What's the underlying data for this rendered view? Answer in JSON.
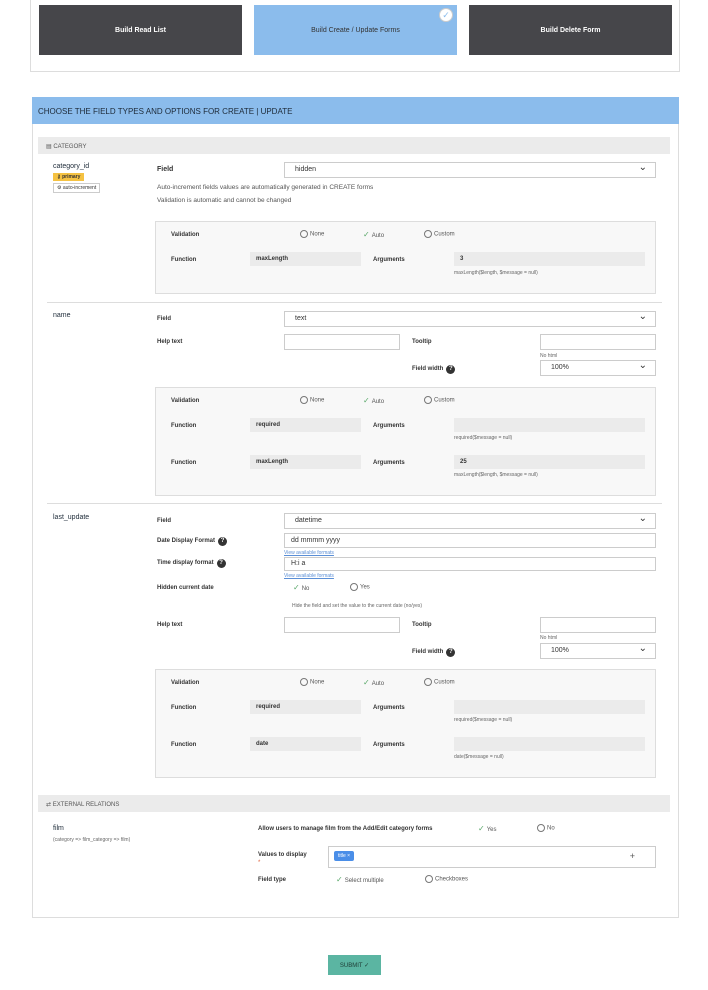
{
  "top_buttons": [
    {
      "label": "Build Read List",
      "selected": false
    },
    {
      "label": "Build Create / Update Forms",
      "selected": true
    },
    {
      "label": "Build Delete Form",
      "selected": false
    }
  ],
  "panel_title": "CHOOSE THE FIELD TYPES AND OPTIONS FOR CREATE | UPDATE",
  "section_category": "CATEGORY",
  "section_relations": "EXTERNAL RELATIONS",
  "labels": {
    "field": "Field",
    "help_text": "Help text",
    "tooltip": "Tooltip",
    "no_html": "No html",
    "field_width": "Field width",
    "validation": "Validation",
    "function": "Function",
    "arguments": "Arguments",
    "none": "None",
    "auto": "Auto",
    "custom": "Custom",
    "date_format": "Date Display Format",
    "time_format": "Time display format",
    "view_formats": "View available formats",
    "hidden_current_date": "Hidden current date",
    "no": "No",
    "yes": "Yes",
    "hidden_hint": "Hide the field and set the value to the current date (no/yes)"
  },
  "fields": {
    "category_id": {
      "name": "category_id",
      "badge_primary": "primary",
      "badge_ai": "auto-increment",
      "type": "hidden",
      "info1": "Auto-increment fields values are automatically generated in CREATE forms",
      "info2": "Validation is automatic and cannot be changed",
      "validations": [
        {
          "function": "maxLength",
          "argument": "3",
          "signature": "maxLength($length, $message = null)"
        }
      ]
    },
    "name": {
      "name": "name",
      "type": "text",
      "help_text": "",
      "tooltip": "",
      "width": "100%",
      "validations": [
        {
          "function": "required",
          "argument": "",
          "signature": "required($message = null)"
        },
        {
          "function": "maxLength",
          "argument": "25",
          "signature": "maxLength($length, $message = null)"
        }
      ]
    },
    "last_update": {
      "name": "last_update",
      "type": "datetime",
      "date_format": "dd mmmm yyyy",
      "time_format": "H:i a",
      "help_text": "",
      "tooltip": "",
      "width": "100%",
      "validations": [
        {
          "function": "required",
          "argument": "",
          "signature": "required($message = null)"
        },
        {
          "function": "date",
          "argument": "",
          "signature": "date($message = null)"
        }
      ]
    }
  },
  "relation": {
    "name": "film",
    "path": "(category => film_category => film)",
    "allow_label": "Allow users to manage film from the Add/Edit category forms",
    "values_label": "Values to display",
    "required_mark": "*",
    "tag": "title",
    "tag_remove": "×",
    "add": "+",
    "field_type_label": "Field type",
    "opt_select": "Select multiple",
    "opt_checkboxes": "Checkboxes",
    "yes": "Yes",
    "no": "No"
  },
  "submit": "SUBMIT ✓",
  "colors": {
    "dark_button": "#46464a",
    "accent_blue": "#8bbcec",
    "submit": "#5bb5a2",
    "primary_badge": "#f5c242"
  }
}
